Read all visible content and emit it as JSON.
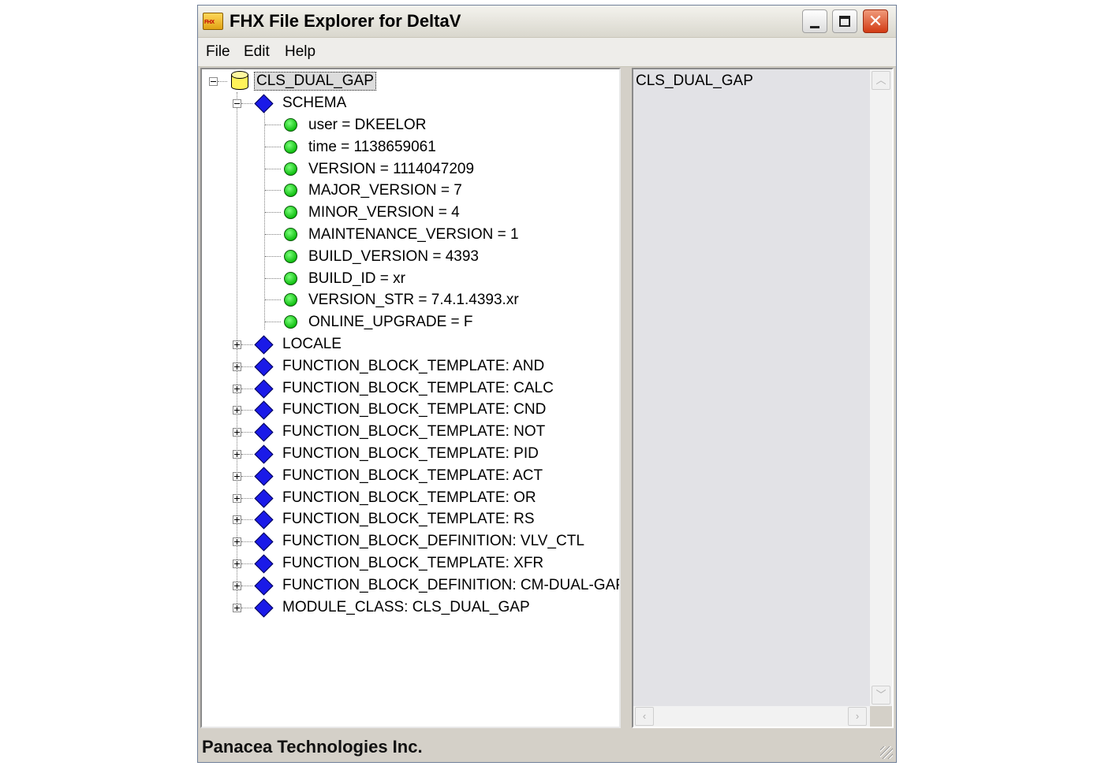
{
  "window": {
    "title": "FHX File Explorer for DeltaV",
    "app_icon_text": "FHX",
    "close_glyph": "✕"
  },
  "menu": [
    "File",
    "Edit",
    "Help"
  ],
  "tree": {
    "root": {
      "label": "CLS_DUAL_GAP",
      "icon": "database-icon",
      "expanded": true,
      "selected": true
    },
    "schema": {
      "label": "SCHEMA",
      "icon": "diamond-icon",
      "expanded": true,
      "properties": [
        "user = DKEELOR",
        "time = 1138659061",
        "VERSION = 1114047209",
        "MAJOR_VERSION = 7",
        "MINOR_VERSION = 4",
        "MAINTENANCE_VERSION = 1",
        "BUILD_VERSION = 4393",
        "BUILD_ID = xr",
        "VERSION_STR = 7.4.1.4393.xr",
        "ONLINE_UPGRADE = F"
      ]
    },
    "collapsed_nodes": [
      "LOCALE",
      "FUNCTION_BLOCK_TEMPLATE: AND",
      "FUNCTION_BLOCK_TEMPLATE: CALC",
      "FUNCTION_BLOCK_TEMPLATE: CND",
      "FUNCTION_BLOCK_TEMPLATE: NOT",
      "FUNCTION_BLOCK_TEMPLATE: PID",
      "FUNCTION_BLOCK_TEMPLATE: ACT",
      "FUNCTION_BLOCK_TEMPLATE: OR",
      "FUNCTION_BLOCK_TEMPLATE: RS",
      "FUNCTION_BLOCK_DEFINITION: VLV_CTL",
      "FUNCTION_BLOCK_TEMPLATE: XFR",
      "FUNCTION_BLOCK_DEFINITION: CM-DUAL-GAP",
      "MODULE_CLASS: CLS_DUAL_GAP"
    ]
  },
  "detail": {
    "text": "CLS_DUAL_GAP"
  },
  "status": {
    "text": "Panacea Technologies Inc."
  },
  "colors": {
    "diamond": "#1a1ae8",
    "property_dot": "#12c012",
    "database": "#fff35a",
    "detail_bg": "#e2e2e6"
  }
}
